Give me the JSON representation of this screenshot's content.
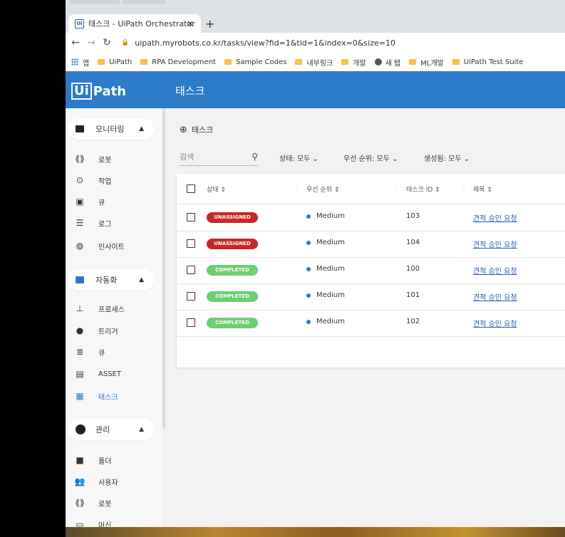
{
  "browser": {
    "tab_title": "태스크 - UiPath Orchestrator",
    "tab_close": "×",
    "new_tab": "+",
    "url": "uipath.myrobots.co.kr/tasks/view?fid=1&tid=1&index=0&size=10",
    "bookmarks": [
      "앱",
      "UiPath",
      "RPA Development",
      "Sample Codes",
      "내부링크",
      "개발",
      "새 탭",
      "ML개발",
      "UiPath Test Suite"
    ]
  },
  "app": {
    "logo_ui": "Ui",
    "logo_path": "Path",
    "title": "태스크"
  },
  "sidebar": {
    "sections": [
      {
        "label": "모니터링",
        "items": [
          "로봇",
          "작업",
          "큐",
          "로그",
          "인사이트"
        ]
      },
      {
        "label": "자동화",
        "items": [
          "프로세스",
          "트리거",
          "큐",
          "ASSET",
          "태스크"
        ]
      },
      {
        "label": "관리",
        "items": [
          "폴더",
          "사용자",
          "로봇",
          "머신"
        ]
      }
    ]
  },
  "main": {
    "breadcrumb": "태스크",
    "search_placeholder": "검색",
    "filters": [
      "상태: 모두",
      "우선 순위: 모두",
      "생성됨: 모두"
    ],
    "columns": [
      "상태",
      "우선 순위",
      "태스크 ID",
      "제목"
    ],
    "rows": [
      {
        "status": "UNASSIGNED",
        "priority": "Medium",
        "id": "103",
        "title": "견적 승인 요청"
      },
      {
        "status": "UNASSIGNED",
        "priority": "Medium",
        "id": "104",
        "title": "견적 승인 요청"
      },
      {
        "status": "COMPLETED",
        "priority": "Medium",
        "id": "100",
        "title": "견적 승인 요청"
      },
      {
        "status": "COMPLETED",
        "priority": "Medium",
        "id": "101",
        "title": "견적 승인 요청"
      },
      {
        "status": "COMPLETED",
        "priority": "Medium",
        "id": "102",
        "title": "견적 승인 요청"
      }
    ]
  },
  "colors": {
    "primary": "#2b7bc8",
    "unassigned": "#c62828",
    "completed": "#6ccf72"
  }
}
